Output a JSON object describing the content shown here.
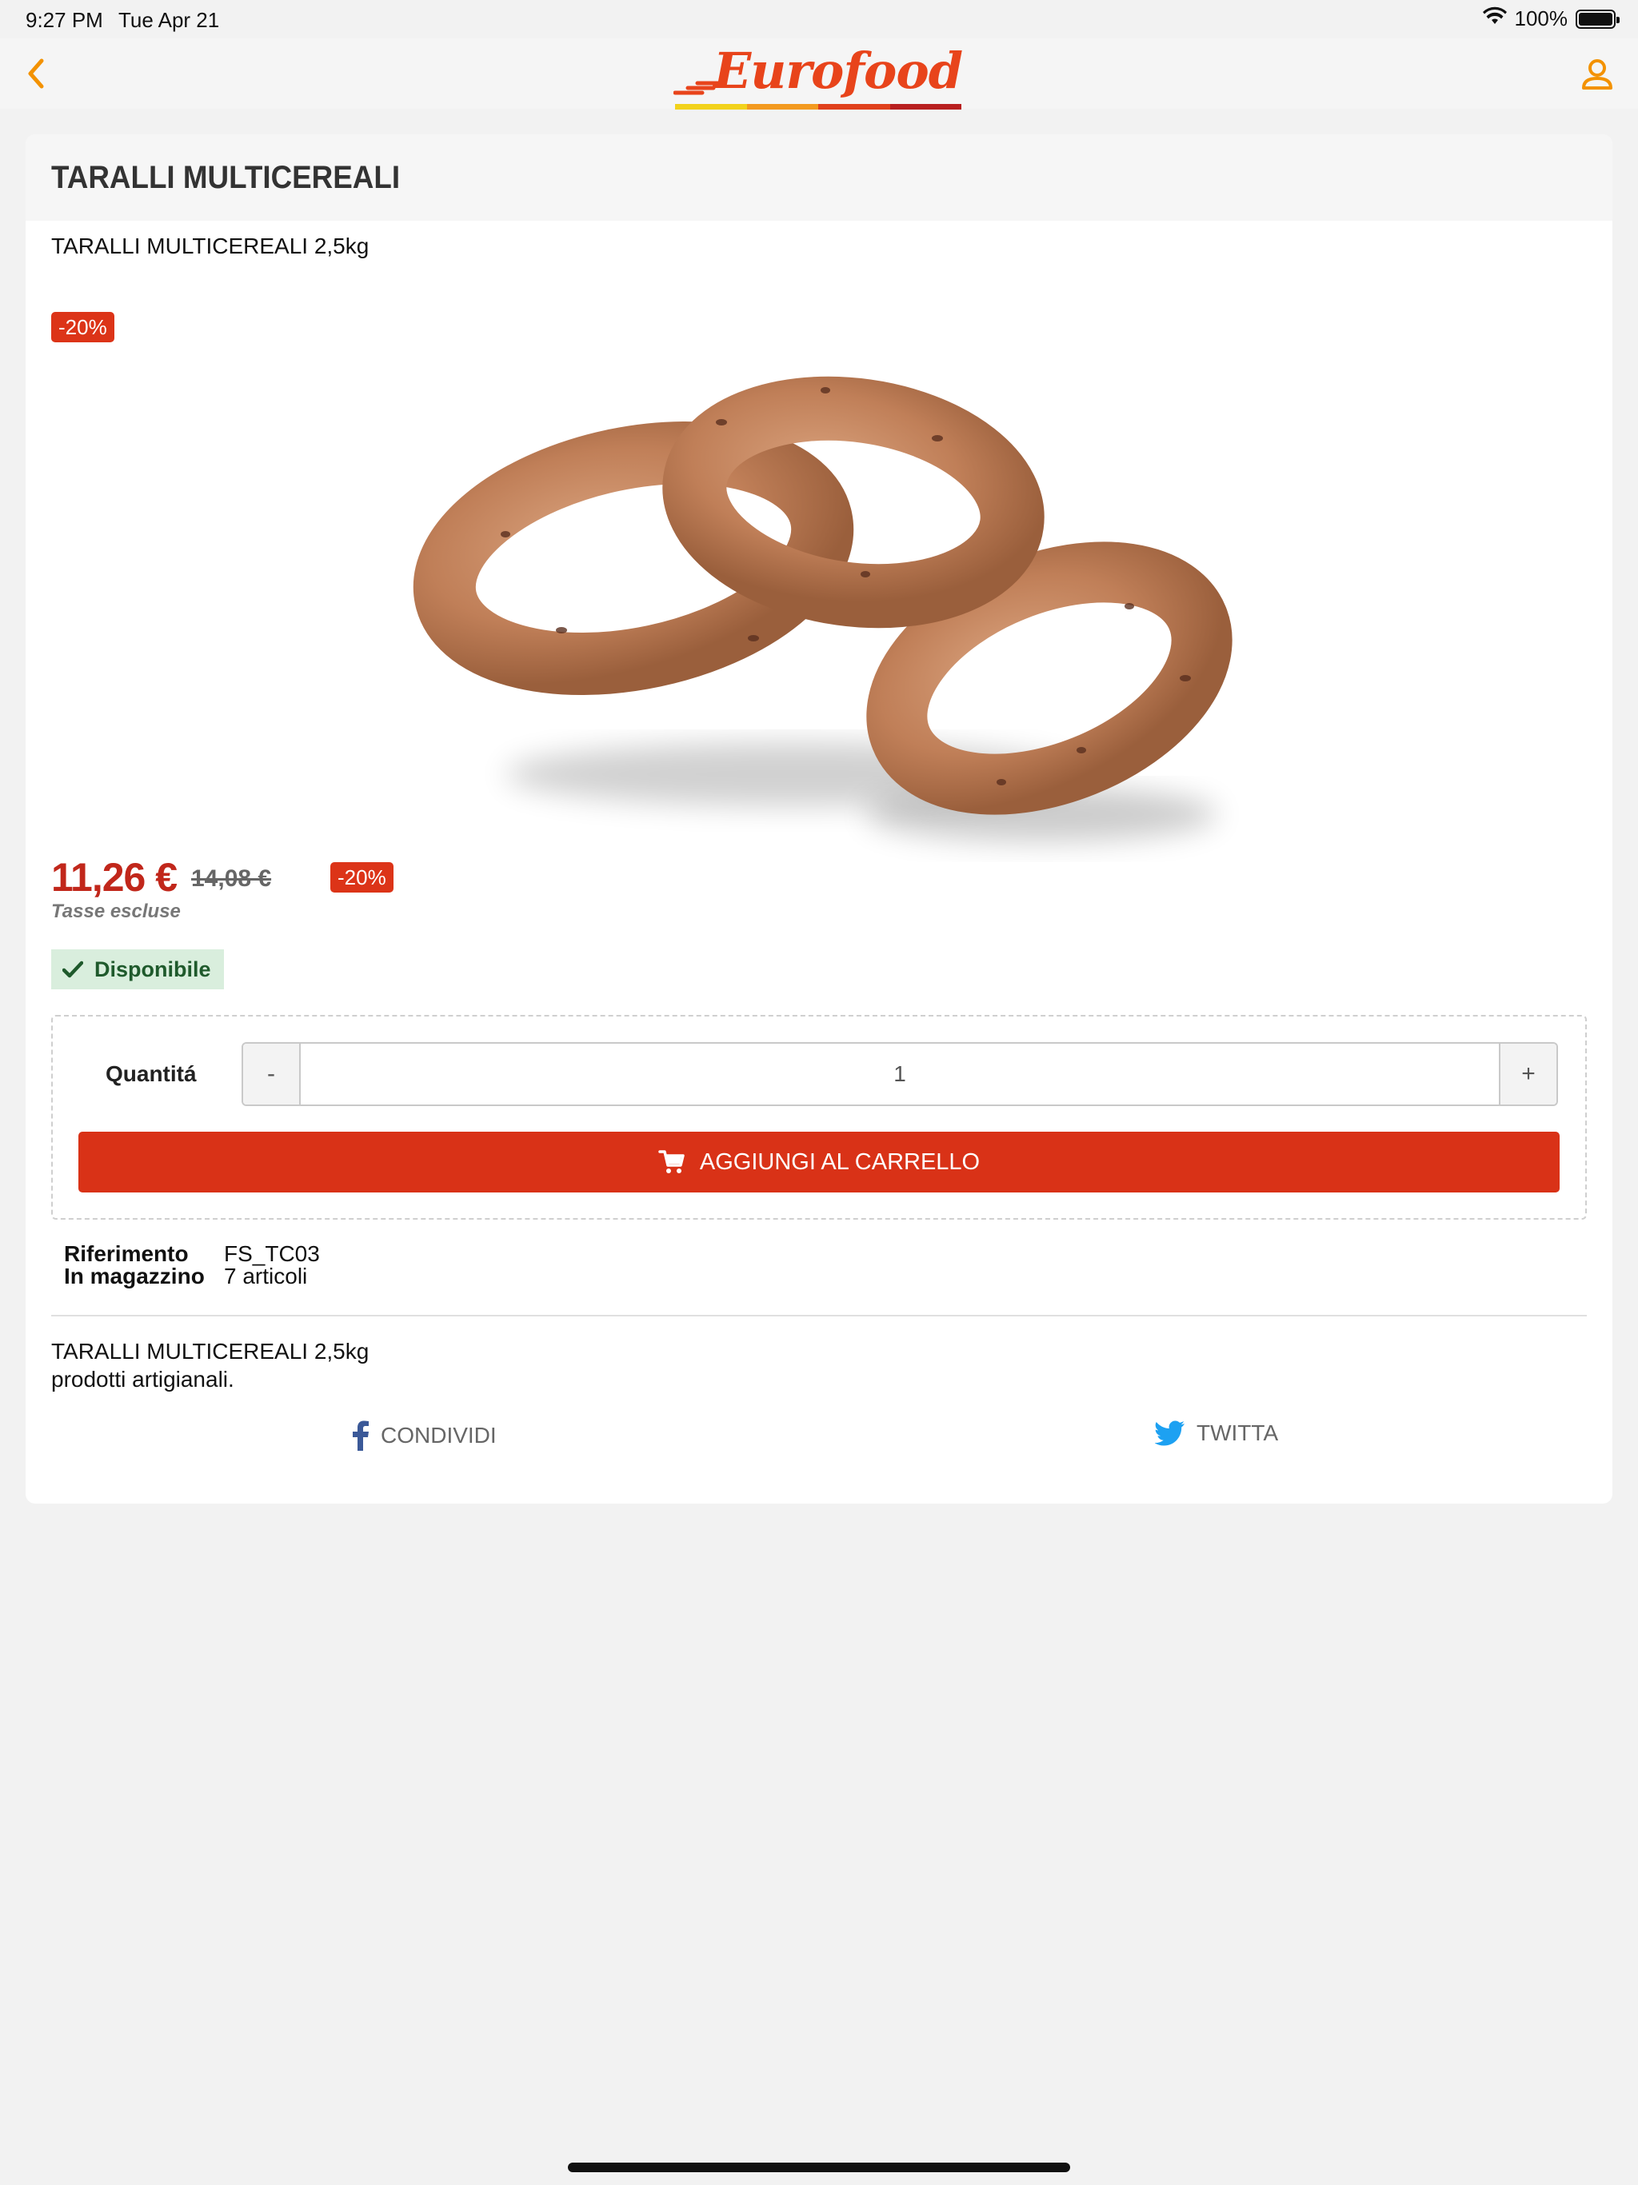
{
  "status_bar": {
    "time": "9:27 PM",
    "date": "Tue Apr 21",
    "battery": "100%"
  },
  "nav": {
    "logo_text": "Eurofood",
    "accent_color": "#f39200",
    "logo_color": "#e8441b"
  },
  "product": {
    "title": "TARALLI MULTICEREALI",
    "subtitle": "TARALLI MULTICEREALI 2,5kg",
    "image_badge": "-20%",
    "price": "11,26 €",
    "old_price": "14,08 €",
    "price_badge": "-20%",
    "tax_note": "Tasse escluse",
    "availability": "Disponibile"
  },
  "purchase": {
    "quantity_label": "Quantitá",
    "minus_label": "-",
    "plus_label": "+",
    "quantity_value": "1",
    "add_to_cart_label": "AGGIUNGI AL CARRELLO",
    "button_color": "#d93217"
  },
  "details": {
    "reference_label": "Riferimento",
    "reference_value": "FS_TC03",
    "stock_label": "In magazzino",
    "stock_value": "7 articoli"
  },
  "description": {
    "line1": "TARALLI MULTICEREALI 2,5kg",
    "line2": "prodotti artigianali."
  },
  "share": {
    "facebook_label": "CONDIVIDI",
    "twitter_label": "TWITTA"
  },
  "icons": {
    "back": "chevron-left-icon",
    "user": "user-icon",
    "wifi": "wifi-icon",
    "battery": "battery-icon",
    "check": "check-icon",
    "cart": "cart-icon",
    "facebook": "facebook-icon",
    "twitter": "twitter-icon"
  }
}
